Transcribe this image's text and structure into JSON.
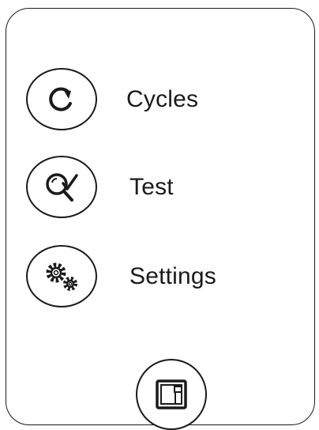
{
  "menu": {
    "items": [
      {
        "label": "Cycles",
        "icon": "refresh-cycle-icon"
      },
      {
        "label": "Test",
        "icon": "search-check-icon"
      },
      {
        "label": "Settings",
        "icon": "gears-icon"
      }
    ]
  },
  "footer": {
    "button_icon": "door-panel-icon"
  },
  "colors": {
    "stroke": "#1a1a1a",
    "background": "#ffffff"
  }
}
